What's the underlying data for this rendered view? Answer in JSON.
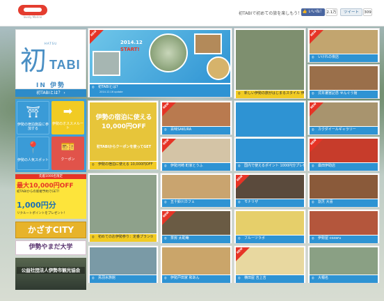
{
  "header": {
    "logo_sub": "lovely Marine",
    "notice": "初TABIで初めての旅を楽しもう！",
    "like_label": "👍 いいね！",
    "like_count": "2.1万",
    "tweet_label": "ツイート",
    "tweet_count": "309"
  },
  "sidebar": {
    "hero_small": "HATSU",
    "hero_kanji": "初",
    "hero_tabi": "TABI",
    "hero_sub": "IN 伊勢",
    "about": "初TABIとは？ ›",
    "menu": [
      {
        "icon": "⛩",
        "label": "伊勢の宿泊施設に参加する"
      },
      {
        "icon": "➡",
        "label": "伊勢のオススメルート"
      },
      {
        "icon": "📍",
        "label": "伊勢の人気スポット"
      },
      {
        "icon": "🎫",
        "label": "クーポン"
      }
    ],
    "ads": {
      "ad1_band": "先着1000名限定",
      "ad1_big": "最大10,000円OFF",
      "ad1_mid": "初TABIからの新規予約でGET！",
      "ad1_pts": "1,000円分",
      "ad1_tail": "リクルートポイントをプレゼント！",
      "ad2": "かざすCITY",
      "ad3": "伊勢やまだ大学",
      "ad4": "公益社団法人伊勢市観光協会"
    }
  },
  "feature": {
    "date_text": "2014.12",
    "start_text": "START!",
    "caption": "初TABIとは？",
    "date": "2014.12.16 update"
  },
  "tiles": [
    {
      "caption": "いけれの夜店",
      "new": true,
      "cap": "blue"
    },
    {
      "caption": "新しい伊勢の旅がはじまるスタイル 伊勢参拝プラン",
      "new": false,
      "cap": "yellow"
    },
    {
      "caption": "式年遷宮記念 せんぐう館",
      "new": false,
      "cap": "blue"
    },
    {
      "caption": "伊勢の宿泊に使える 10,000円OFF",
      "new": false,
      "cap": "yellow",
      "sub": "初TABIからクーポンを使ってGET"
    },
    {
      "caption": "百味SAKURA",
      "new": true,
      "cap": "blue"
    },
    {
      "caption": "1,000円分のリクルートポイントを先着2,000名にプレゼント！",
      "new": false,
      "cap": "blue"
    },
    {
      "caption": "カクダイールギャラリー",
      "new": true,
      "cap": "blue"
    },
    {
      "caption": "伊勢河崎 町家とうふ",
      "new": true,
      "cap": "blue"
    },
    {
      "caption": "国内で使えるポイント 1000円分プレゼント",
      "new": false,
      "cap": "blue"
    },
    {
      "caption": "桑田伊助店",
      "new": true,
      "cap": "blue"
    },
    {
      "caption": "初めてのお伊勢参り：定番プラン①",
      "new": false,
      "cap": "yellow"
    },
    {
      "caption": "五十鈴川カフェ",
      "new": false,
      "cap": "blue"
    },
    {
      "caption": "モナリザ",
      "new": true,
      "cap": "blue"
    },
    {
      "caption": "割烹 大喜",
      "new": false,
      "cap": "blue"
    },
    {
      "caption": "茶房 太助庵",
      "new": true,
      "cap": "blue"
    },
    {
      "caption": "フルーツラボ",
      "new": false,
      "cap": "blue"
    },
    {
      "caption": "伊勢屋 cozaru",
      "new": false,
      "cap": "blue"
    },
    {
      "caption": "鳥羽水族館",
      "new": false,
      "cap": "blue"
    },
    {
      "caption": "伊勢戸田家 和あん",
      "new": false,
      "cap": "blue"
    },
    {
      "caption": "横田屋 吉上吉",
      "new": true,
      "cap": "blue"
    },
    {
      "caption": "大幡名",
      "new": false,
      "cap": "blue"
    }
  ],
  "labels": {
    "new": "NEW",
    "date": "2014.12.16 update"
  },
  "colors": {
    "accent_blue": "#2e93d3",
    "yellow": "#f1cb23",
    "red": "#e63426"
  }
}
